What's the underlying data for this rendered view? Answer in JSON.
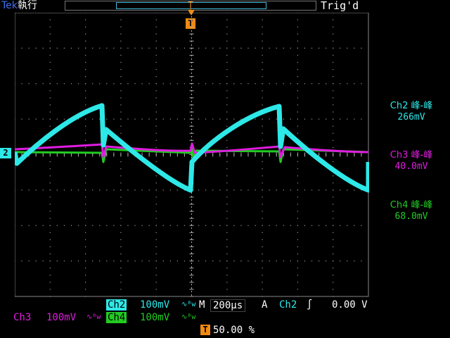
{
  "header": {
    "brand": "Tek",
    "run_state": "執行",
    "trigger_status": "Trig'd",
    "trigger_marker": "T"
  },
  "channel_marker": "2",
  "measurements": [
    {
      "name": "Ch2 峰-峰",
      "value": "266mV",
      "color": "#2ee8e8"
    },
    {
      "name": "Ch3 峰-峰",
      "value": "40.0mV",
      "color": "#e01ce0"
    },
    {
      "name": "Ch4 峰-峰",
      "value": "68.0mV",
      "color": "#22cc22"
    }
  ],
  "status_bar": {
    "ch2_label": "Ch2",
    "ch2_scale": "100mV",
    "ch3_label": "Ch3",
    "ch3_scale": "100mV",
    "ch4_label": "Ch4",
    "ch4_scale": "100mV",
    "bw_icon": "∿ᴮw",
    "timebase_prefix": "M",
    "timebase": "200µs",
    "trigger_mode": "A",
    "trigger_source": "Ch2",
    "trigger_slope": "∫",
    "trigger_level": "0.00 V",
    "trigger_marker": "T",
    "trigger_position": "50.00 %"
  },
  "colors": {
    "ch2": "#2ee8e8",
    "ch3": "#e01ce0",
    "ch4": "#22cc22",
    "trigger": "#f08a12"
  }
}
